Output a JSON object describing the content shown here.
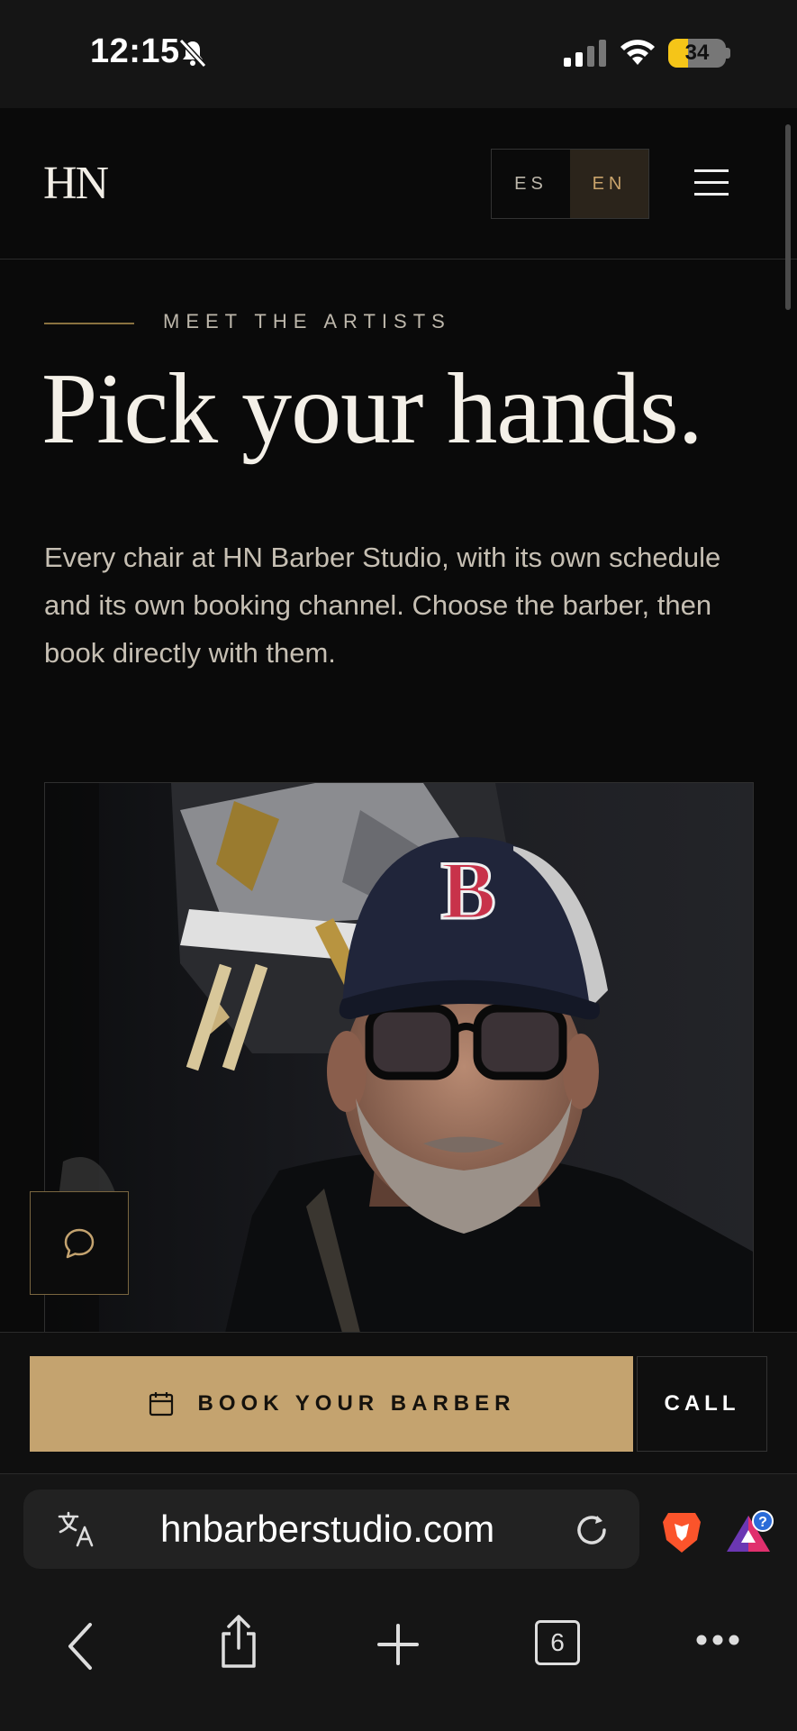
{
  "status_bar": {
    "time": "12:15",
    "battery": "34",
    "battery_level": 0.34
  },
  "header": {
    "logo": "HN",
    "lang_es": "ES",
    "lang_en": "EN",
    "active_lang": "EN"
  },
  "hero": {
    "eyebrow": "MEET THE ARTISTS",
    "headline": "Pick your hands.",
    "description": "Every chair at HN Barber Studio, with its own schedule and its own booking channel. Choose the barber, then book directly with them."
  },
  "actions": {
    "book_label": "BOOK YOUR BARBER",
    "call_label": "CALL"
  },
  "browser": {
    "url": "hnbarberstudio.com",
    "tabs_count": "6",
    "badge": "?"
  },
  "colors": {
    "accent_gold": "#c4a36f",
    "background": "#0a0a0a",
    "text": "#f4f0e8"
  },
  "icons": [
    "bell-slash-icon",
    "signal-icon",
    "wifi-icon",
    "battery-icon",
    "hamburger-icon",
    "chat-icon",
    "calendar-icon",
    "translate-icon",
    "reload-icon",
    "brave-lion-icon",
    "triangle-rewards-icon",
    "back-icon",
    "share-icon",
    "new-tab-icon",
    "tabs-icon",
    "more-icon"
  ]
}
